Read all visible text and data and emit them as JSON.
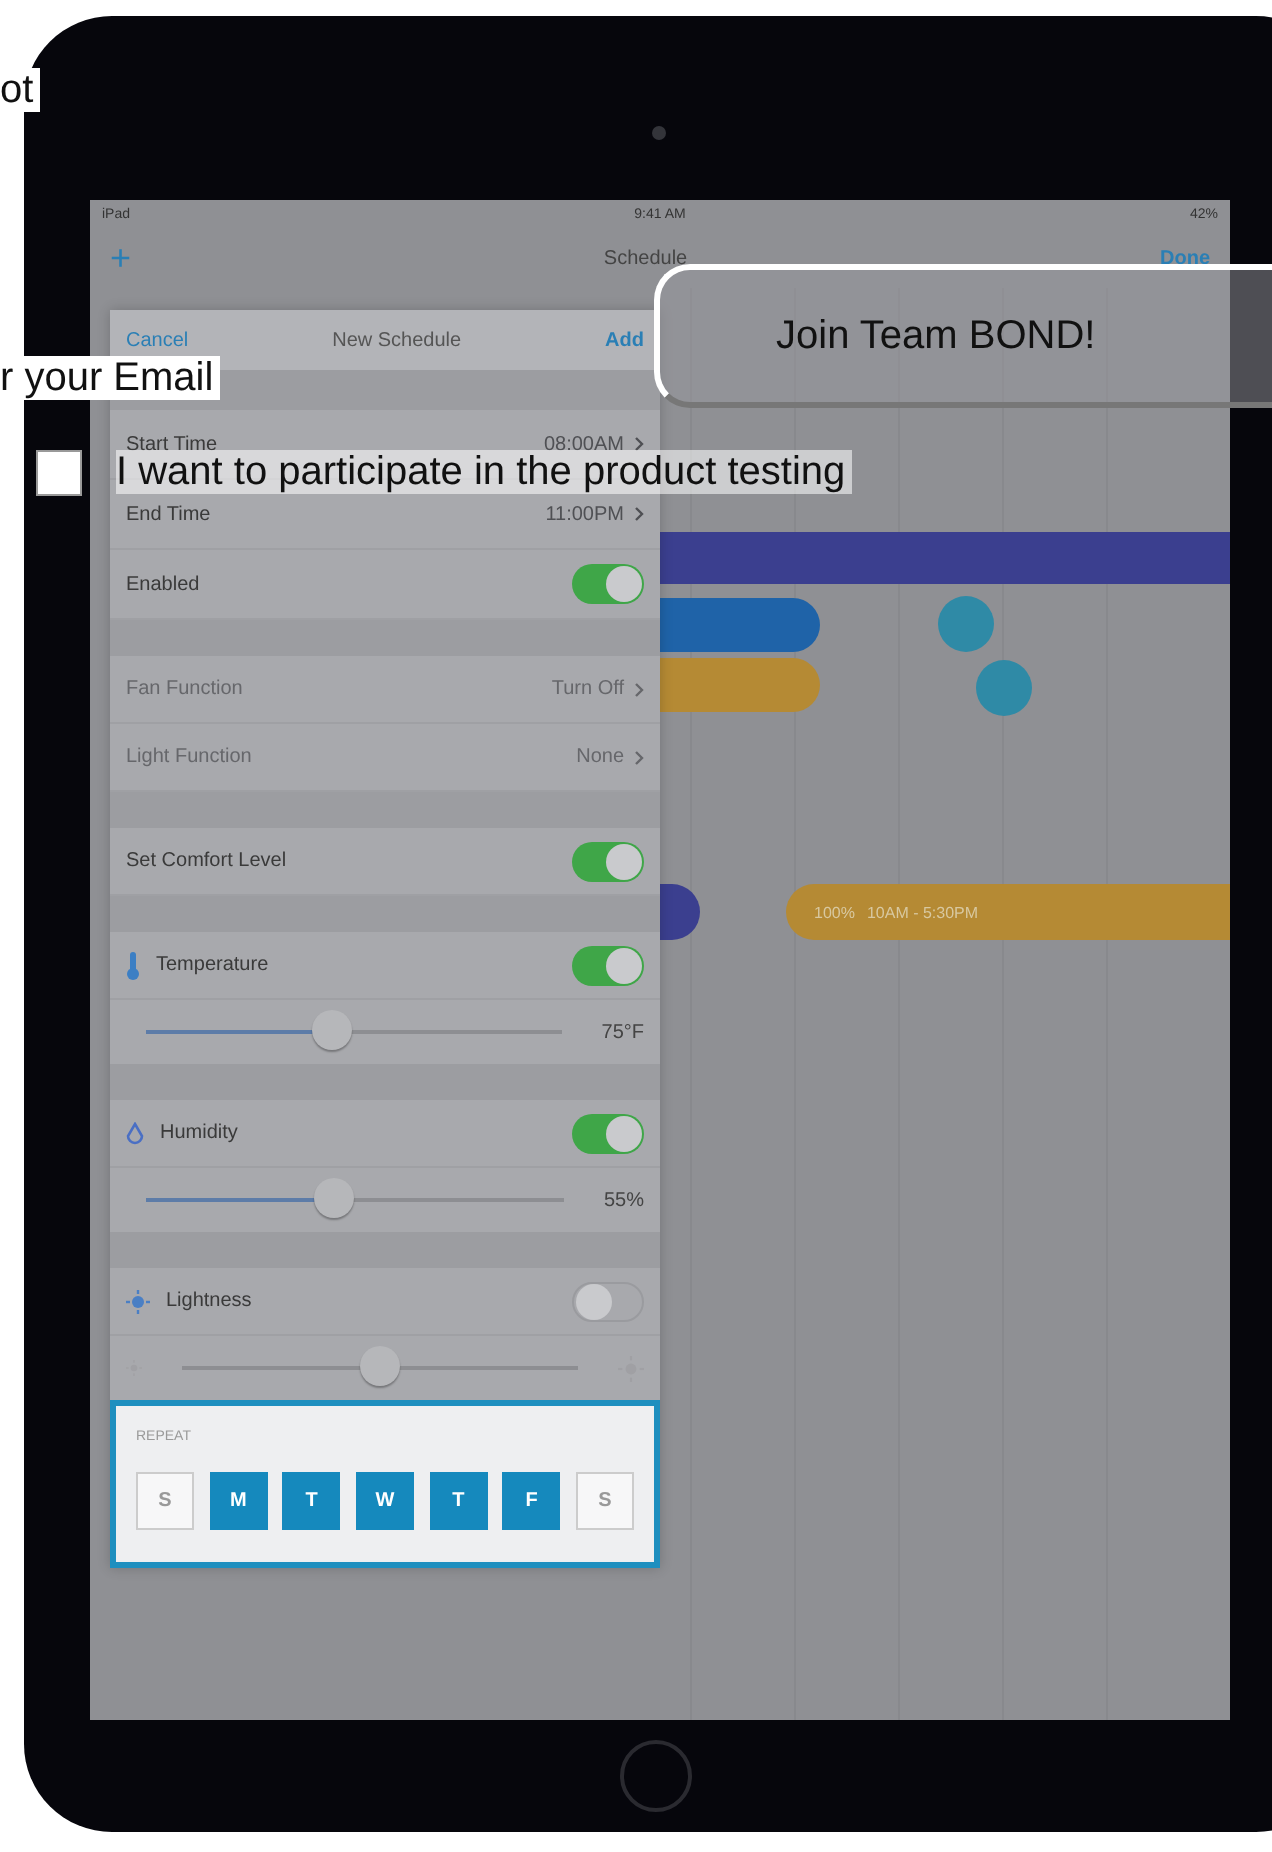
{
  "overlay": {
    "heading": "ot",
    "email_label": "r your Email",
    "consent": {
      "label": "I want to participate in the product testing",
      "checked": false
    },
    "join_button": "Join Team BOND!"
  },
  "status_bar": {
    "carrier": "iPad",
    "time": "9:41 AM",
    "battery": "42%"
  },
  "nav": {
    "add": "+",
    "title": "Schedule",
    "done": "Done"
  },
  "timeline": {
    "bars": [
      {
        "color": "#3b3f8f"
      },
      {
        "color": "#1f63a8"
      },
      {
        "color": "#b58a34"
      },
      {
        "color": "#2f8aa6"
      },
      {
        "color": "#2f8aa6"
      },
      {
        "color": "#3b3f8f"
      },
      {
        "color": "#b58a34",
        "level_text": "100%",
        "time_text": "10AM - 5:30PM"
      }
    ]
  },
  "popover": {
    "cancel": "Cancel",
    "title": "New Schedule",
    "add": "Add",
    "sections": [
      [
        {
          "kind": "value",
          "label": "Start Time",
          "value": "08:00AM",
          "disabled": false
        },
        {
          "kind": "value",
          "label": "End Time",
          "value": "11:00PM",
          "disabled": false
        },
        {
          "kind": "toggle",
          "label": "Enabled",
          "on": true
        }
      ],
      [
        {
          "kind": "value",
          "label": "Fan Function",
          "value": "Turn Off",
          "disabled": true
        },
        {
          "kind": "value",
          "label": "Light Function",
          "value": "None",
          "disabled": true
        }
      ],
      [
        {
          "kind": "toggle",
          "label": "Set Comfort Level",
          "on": true
        }
      ],
      [
        {
          "kind": "thermo",
          "label": "Temperature",
          "on": true
        },
        {
          "kind": "slider",
          "level": 0.45,
          "reading": "75°F"
        }
      ],
      [
        {
          "kind": "drop",
          "label": "Humidity",
          "on": true
        },
        {
          "kind": "slider",
          "level": 0.45,
          "reading": "55%"
        }
      ],
      [
        {
          "kind": "sun",
          "label": "Lightness",
          "on": false
        },
        {
          "kind": "sunslider",
          "level": 0.5
        }
      ]
    ],
    "repeat": {
      "label": "REPEAT",
      "days": [
        {
          "label": "S",
          "selected": false
        },
        {
          "label": "M",
          "selected": true
        },
        {
          "label": "T",
          "selected": true
        },
        {
          "label": "W",
          "selected": true
        },
        {
          "label": "T",
          "selected": true
        },
        {
          "label": "F",
          "selected": true
        },
        {
          "label": "S",
          "selected": false
        }
      ]
    }
  }
}
